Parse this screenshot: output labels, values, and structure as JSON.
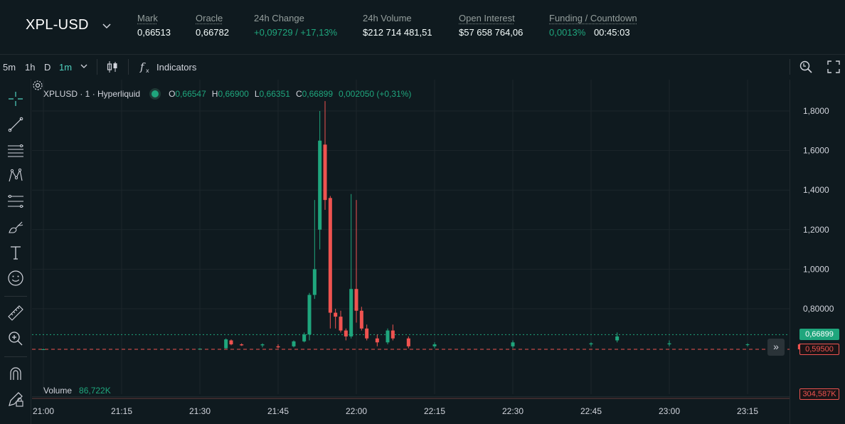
{
  "header": {
    "symbol": "XPL-USD",
    "stats": [
      {
        "label": "Mark",
        "value": "0,66513",
        "dotted": true,
        "green": false
      },
      {
        "label": "Oracle",
        "value": "0,66782",
        "dotted": true,
        "green": false
      },
      {
        "label": "24h Change",
        "value": "+0,09729 / +17,13%",
        "dotted": false,
        "green": true
      },
      {
        "label": "24h Volume",
        "value": "$212 714 481,51",
        "dotted": false,
        "green": false
      },
      {
        "label": "Open Interest",
        "value": "$57 658 764,06",
        "dotted": true,
        "green": false
      },
      {
        "label": "Funding / Countdown",
        "value": "0,0013%",
        "value2": "00:45:03",
        "dotted": true,
        "green": true
      }
    ]
  },
  "toolbar": {
    "timeframes": [
      "5m",
      "1h",
      "D",
      "1m"
    ],
    "active_timeframe": "1m",
    "indicators_label": "Indicators"
  },
  "rail": {
    "icons": [
      "crosshair-icon",
      "trend-line-icon",
      "horizontal-lines-icon",
      "pattern-icon",
      "fib-icon",
      "brush-icon",
      "text-icon",
      "emoji-icon",
      "ruler-icon",
      "zoom-in-icon",
      "magnet-icon",
      "lock-pencil-icon"
    ]
  },
  "legend": {
    "title": "XPLUSD · 1 · Hyperliquid",
    "o_label": "O",
    "o": "0,66547",
    "h_label": "H",
    "h": "0,66900",
    "l_label": "L",
    "l": "0,66351",
    "c_label": "C",
    "c": "0,66899",
    "change": "0,002050 (+0,31%)"
  },
  "volume": {
    "label": "Volume",
    "value": "86,722K",
    "axis_tag": "304,587K"
  },
  "price_tags": {
    "last": "0,66899",
    "line": "0,59500"
  },
  "colors": {
    "up": "#1fa67d",
    "down": "#ef5350",
    "bg": "#0f1a1f",
    "grid": "#1c262b",
    "accent": "#50d2c1"
  },
  "chart_data": {
    "type": "candlestick",
    "ylim": [
      0.55,
      1.85
    ],
    "y_ticks": [
      "1,8000",
      "1,6000",
      "1,4000",
      "1,2000",
      "1,0000",
      "0,80000"
    ],
    "y_tick_values": [
      1.8,
      1.6,
      1.4,
      1.2,
      1.0,
      0.8
    ],
    "x_ticks": [
      "21:00",
      "21:15",
      "21:30",
      "21:45",
      "22:00",
      "22:15",
      "22:30",
      "22:45",
      "23:00",
      "23:15"
    ],
    "last_price": 0.66899,
    "line_price": 0.595,
    "series": [
      {
        "t": "21:00",
        "o": 0.595,
        "h": 0.598,
        "l": 0.592,
        "c": 0.595
      },
      {
        "t": "21:30",
        "o": 0.596,
        "h": 0.6,
        "l": 0.593,
        "c": 0.598
      },
      {
        "t": "21:35",
        "o": 0.6,
        "h": 0.65,
        "l": 0.598,
        "c": 0.645
      },
      {
        "t": "21:36",
        "o": 0.64,
        "h": 0.645,
        "l": 0.615,
        "c": 0.62
      },
      {
        "t": "21:38",
        "o": 0.62,
        "h": 0.625,
        "l": 0.612,
        "c": 0.615
      },
      {
        "t": "21:42",
        "o": 0.615,
        "h": 0.625,
        "l": 0.605,
        "c": 0.62
      },
      {
        "t": "21:45",
        "o": 0.61,
        "h": 0.62,
        "l": 0.6,
        "c": 0.605
      },
      {
        "t": "21:48",
        "o": 0.61,
        "h": 0.64,
        "l": 0.605,
        "c": 0.635
      },
      {
        "t": "21:50",
        "o": 0.635,
        "h": 0.68,
        "l": 0.63,
        "c": 0.67
      },
      {
        "t": "21:51",
        "o": 0.67,
        "h": 0.88,
        "l": 0.64,
        "c": 0.87
      },
      {
        "t": "21:52",
        "o": 0.87,
        "h": 1.35,
        "l": 0.85,
        "c": 1.0
      },
      {
        "t": "21:53",
        "o": 1.2,
        "h": 1.8,
        "l": 1.1,
        "c": 1.65
      },
      {
        "t": "21:54",
        "o": 1.63,
        "h": 1.85,
        "l": 1.3,
        "c": 1.35
      },
      {
        "t": "21:55",
        "o": 1.36,
        "h": 1.37,
        "l": 0.7,
        "c": 0.78
      },
      {
        "t": "21:56",
        "o": 0.78,
        "h": 0.8,
        "l": 0.7,
        "c": 0.76
      },
      {
        "t": "21:57",
        "o": 0.76,
        "h": 0.79,
        "l": 0.68,
        "c": 0.69
      },
      {
        "t": "21:58",
        "o": 0.69,
        "h": 0.7,
        "l": 0.64,
        "c": 0.66
      },
      {
        "t": "21:59",
        "o": 0.66,
        "h": 1.38,
        "l": 0.65,
        "c": 0.9
      },
      {
        "t": "22:00",
        "o": 0.9,
        "h": 1.35,
        "l": 0.73,
        "c": 0.79
      },
      {
        "t": "22:01",
        "o": 0.79,
        "h": 0.81,
        "l": 0.69,
        "c": 0.7
      },
      {
        "t": "22:02",
        "o": 0.7,
        "h": 0.72,
        "l": 0.64,
        "c": 0.65
      },
      {
        "t": "22:04",
        "o": 0.65,
        "h": 0.67,
        "l": 0.61,
        "c": 0.63
      },
      {
        "t": "22:06",
        "o": 0.63,
        "h": 0.7,
        "l": 0.62,
        "c": 0.69
      },
      {
        "t": "22:07",
        "o": 0.69,
        "h": 0.72,
        "l": 0.64,
        "c": 0.65
      },
      {
        "t": "22:10",
        "o": 0.65,
        "h": 0.66,
        "l": 0.6,
        "c": 0.61
      },
      {
        "t": "22:15",
        "o": 0.61,
        "h": 0.63,
        "l": 0.6,
        "c": 0.62
      },
      {
        "t": "22:30",
        "o": 0.61,
        "h": 0.64,
        "l": 0.6,
        "c": 0.63
      },
      {
        "t": "22:45",
        "o": 0.62,
        "h": 0.63,
        "l": 0.61,
        "c": 0.625
      },
      {
        "t": "22:50",
        "o": 0.64,
        "h": 0.68,
        "l": 0.63,
        "c": 0.66
      },
      {
        "t": "23:00",
        "o": 0.62,
        "h": 0.64,
        "l": 0.61,
        "c": 0.625
      },
      {
        "t": "23:15",
        "o": 0.618,
        "h": 0.625,
        "l": 0.61,
        "c": 0.62
      },
      {
        "t": "23:25",
        "o": 0.62,
        "h": 0.625,
        "l": 0.59,
        "c": 0.595
      }
    ]
  }
}
